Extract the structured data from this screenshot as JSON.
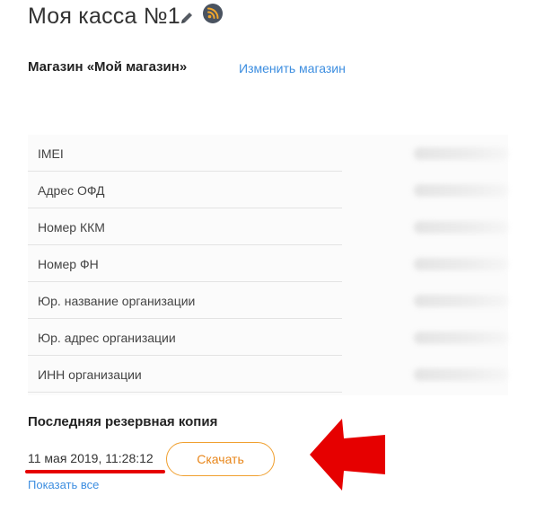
{
  "header": {
    "title": "Моя касса №1",
    "edit_icon": "pencil-icon",
    "status_icon": "rss-icon",
    "status_color": "#f2a72b"
  },
  "store": {
    "name": "Магазин «Мой магазин»",
    "change_link": "Изменить магазин"
  },
  "details": {
    "rows": [
      {
        "label": "IMEI"
      },
      {
        "label": "Адрес ОФД"
      },
      {
        "label": "Номер ККМ"
      },
      {
        "label": "Номер ФН"
      },
      {
        "label": "Юр. название организации"
      },
      {
        "label": "Юр. адрес организации"
      },
      {
        "label": "ИНН организации"
      }
    ]
  },
  "backup": {
    "heading": "Последняя резервная копия",
    "date": "11 мая 2019, 11:28:12",
    "download_label": "Скачать",
    "show_all": "Показать все"
  },
  "colors": {
    "link": "#3d8ee0",
    "accent_orange": "#e8861a",
    "annotation_red": "#e60000"
  }
}
